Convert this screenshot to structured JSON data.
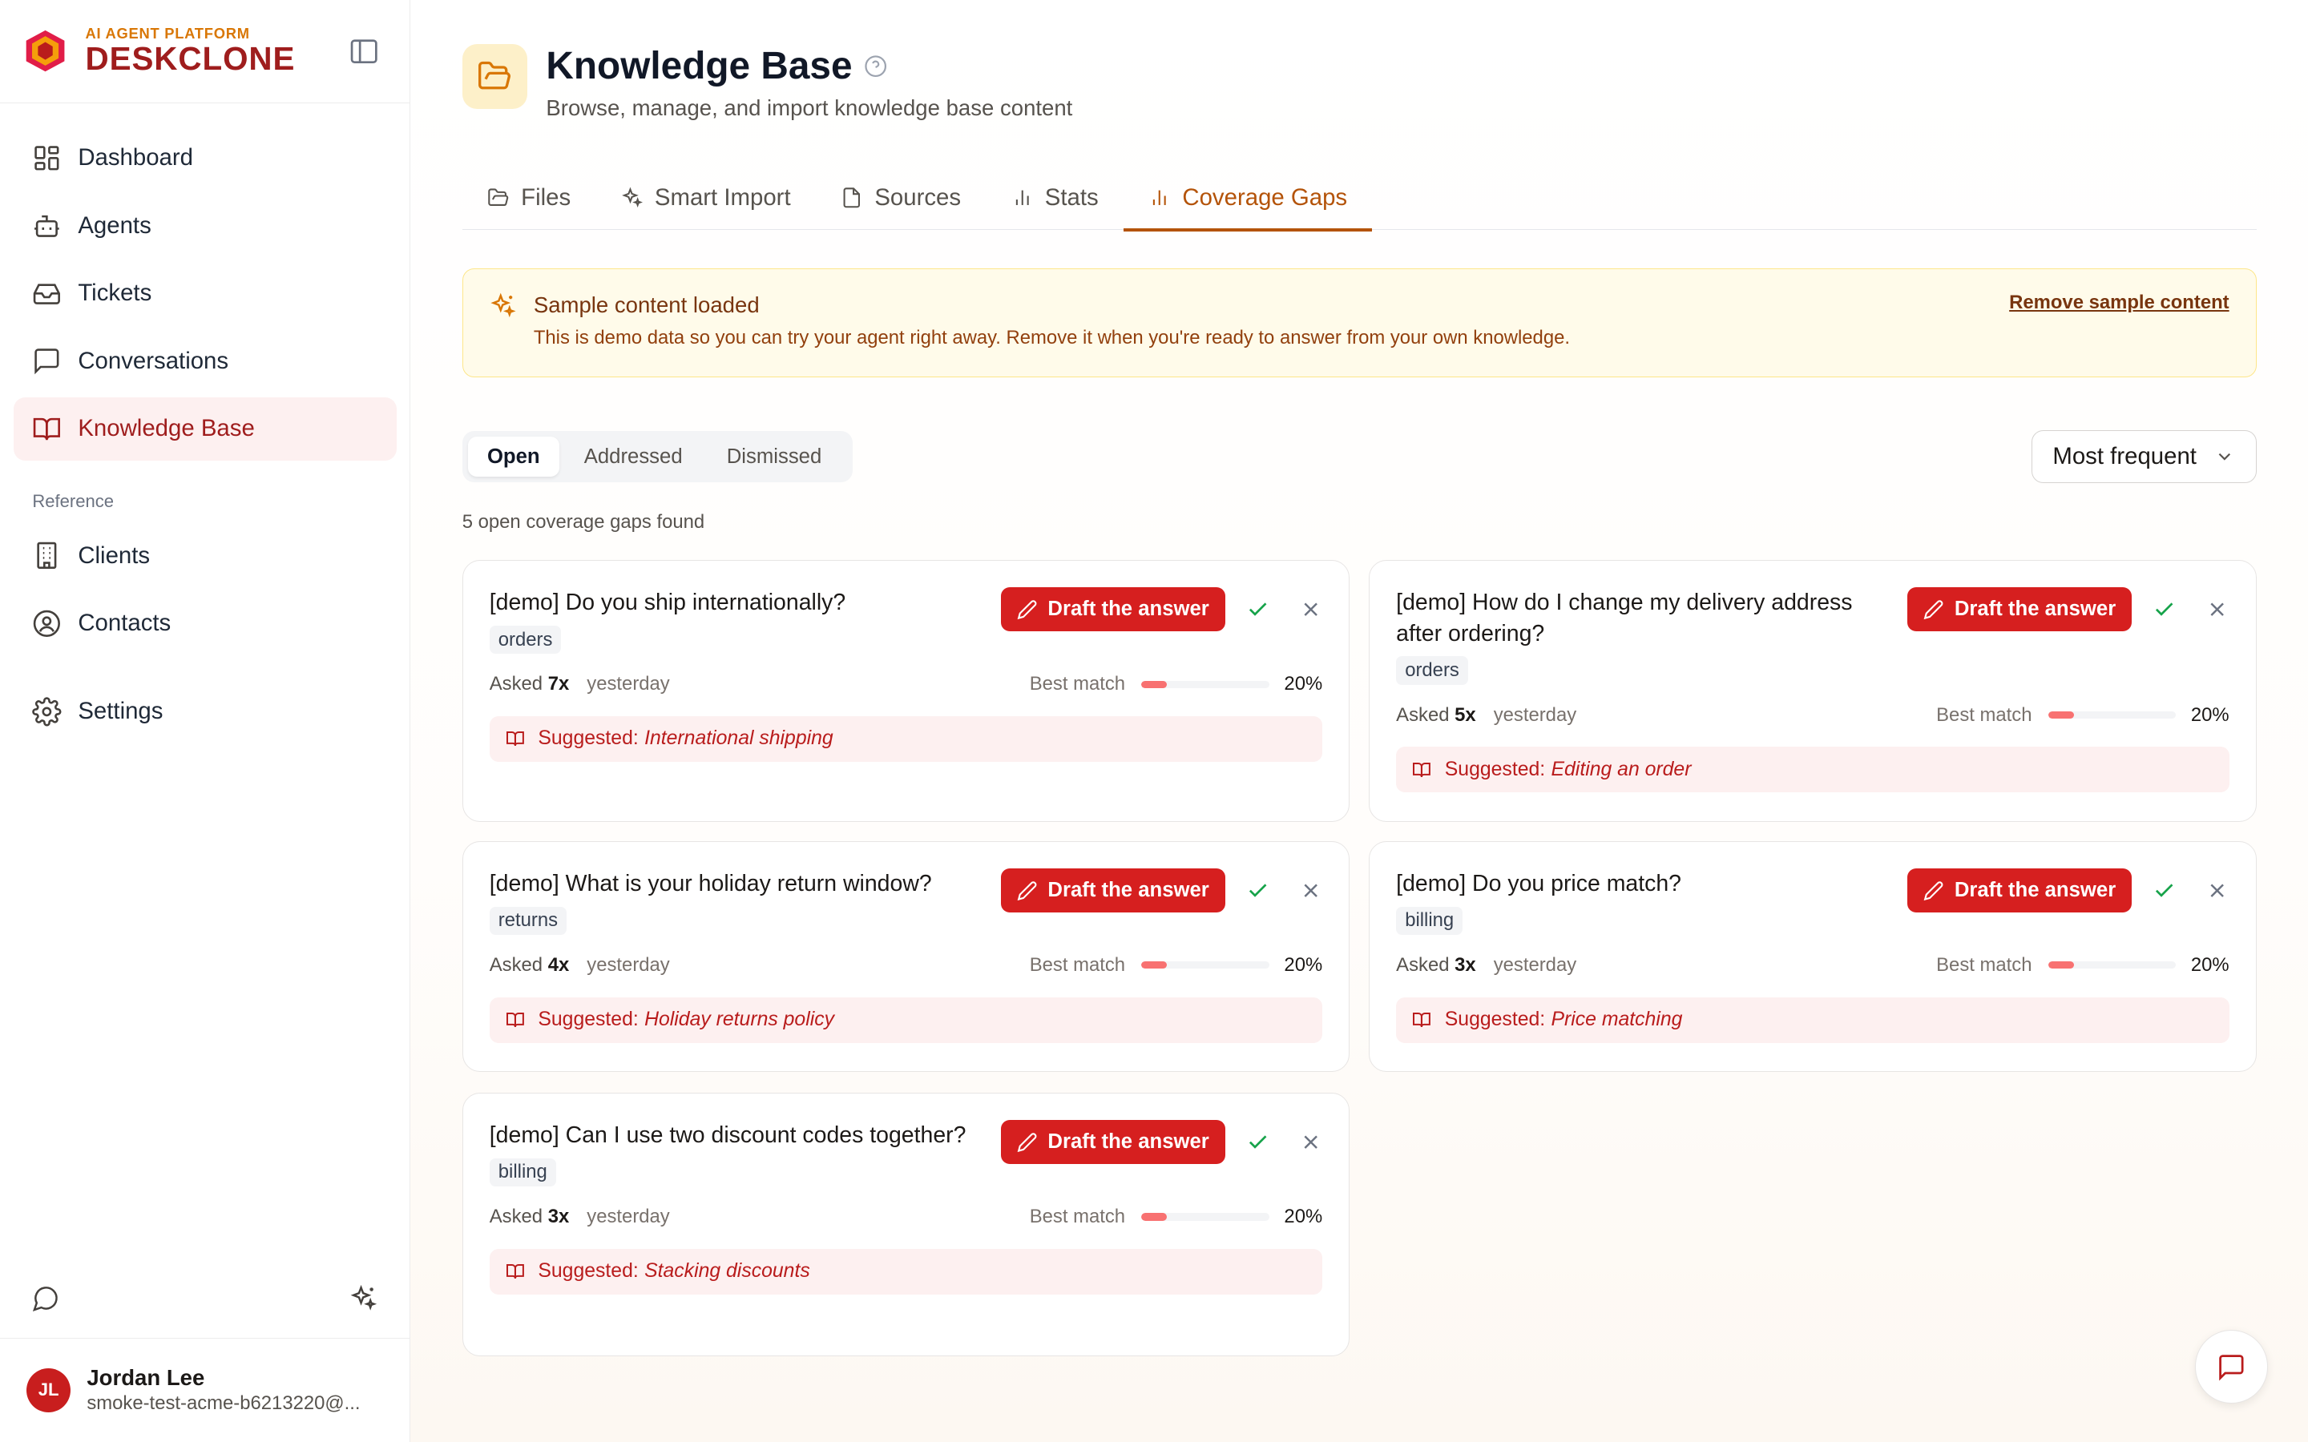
{
  "brand": {
    "kicker": "AI AGENT PLATFORM",
    "name": "DESKCLONE"
  },
  "sidebar": {
    "items": [
      {
        "label": "Dashboard",
        "icon": "dashboard-icon"
      },
      {
        "label": "Agents",
        "icon": "bot-icon"
      },
      {
        "label": "Tickets",
        "icon": "inbox-icon"
      },
      {
        "label": "Conversations",
        "icon": "chat-icon"
      },
      {
        "label": "Knowledge Base",
        "icon": "book-icon",
        "active": true
      }
    ],
    "section_label": "Reference",
    "reference_items": [
      {
        "label": "Clients",
        "icon": "building-icon"
      },
      {
        "label": "Contacts",
        "icon": "user-circle-icon"
      }
    ],
    "settings_label": "Settings"
  },
  "user": {
    "initials": "JL",
    "name": "Jordan Lee",
    "email": "smoke-test-acme-b6213220@..."
  },
  "header": {
    "title": "Knowledge Base",
    "subtitle": "Browse, manage, and import knowledge base content"
  },
  "tabs": [
    {
      "label": "Files",
      "icon": "folder-icon"
    },
    {
      "label": "Smart Import",
      "icon": "sparkles-icon"
    },
    {
      "label": "Sources",
      "icon": "file-icon"
    },
    {
      "label": "Stats",
      "icon": "bar-chart-icon"
    },
    {
      "label": "Coverage Gaps",
      "icon": "bar-chart-icon",
      "active": true
    }
  ],
  "banner": {
    "title": "Sample content loaded",
    "text": "This is demo data so you can try your agent right away. Remove it when you're ready to answer from your own knowledge.",
    "link": "Remove sample content"
  },
  "filters": {
    "segments": [
      "Open",
      "Addressed",
      "Dismissed"
    ],
    "active_segment": "Open",
    "sort": "Most frequent"
  },
  "count_text": "5 open coverage gaps found",
  "card_labels": {
    "draft": "Draft the answer",
    "asked": "Asked",
    "best_match": "Best match",
    "suggested": "Suggested:"
  },
  "gaps": [
    {
      "question": "[demo] Do you ship internationally?",
      "tag": "orders",
      "asked": "7x",
      "when": "yesterday",
      "match_fraction": 0.2,
      "match": "20%",
      "suggestion": "International shipping"
    },
    {
      "question": "[demo] How do I change my delivery address after ordering?",
      "tag": "orders",
      "asked": "5x",
      "when": "yesterday",
      "match_fraction": 0.2,
      "match": "20%",
      "suggestion": "Editing an order"
    },
    {
      "question": "[demo] What is your holiday return window?",
      "tag": "returns",
      "asked": "4x",
      "when": "yesterday",
      "match_fraction": 0.2,
      "match": "20%",
      "suggestion": "Holiday returns policy"
    },
    {
      "question": "[demo] Do you price match?",
      "tag": "billing",
      "asked": "3x",
      "when": "yesterday",
      "match_fraction": 0.2,
      "match": "20%",
      "suggestion": "Price matching"
    },
    {
      "question": "[demo] Can I use two discount codes together?",
      "tag": "billing",
      "asked": "3x",
      "when": "yesterday",
      "match_fraction": 0.2,
      "match": "20%",
      "suggestion": "Stacking discounts"
    }
  ],
  "colors": {
    "accent": "#d61f1f",
    "tab_active": "#b45309",
    "sidebar_active_bg": "#fdf0f0",
    "banner_bg": "#fffbea"
  }
}
